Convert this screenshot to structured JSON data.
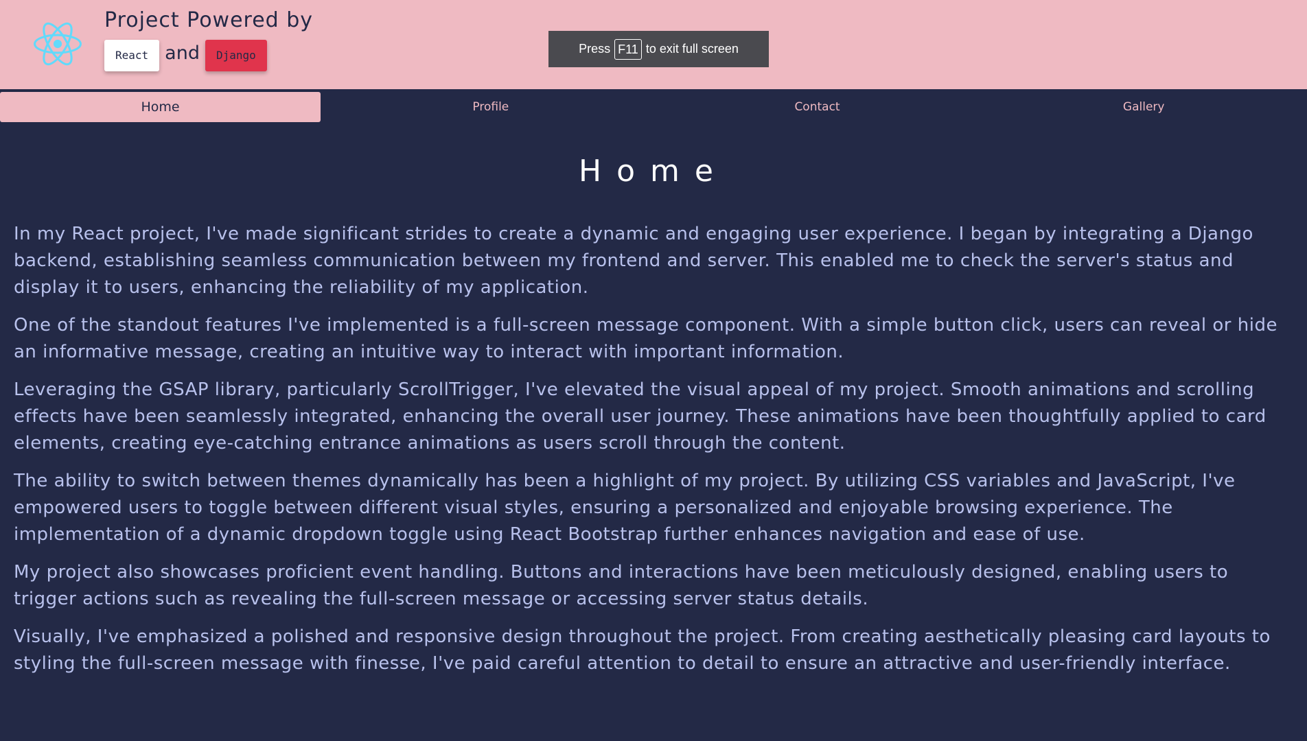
{
  "header": {
    "title": "Project Powered by",
    "badge_react": "React",
    "and_text": "and",
    "badge_django": "Django",
    "logo_color": "#61dafb"
  },
  "fullscreen_notice": {
    "before": "Press",
    "key": "F11",
    "after": "to exit full screen"
  },
  "nav": {
    "tabs": [
      {
        "label": "Home",
        "active": true
      },
      {
        "label": "Profile",
        "active": false
      },
      {
        "label": "Contact",
        "active": false
      },
      {
        "label": "Gallery",
        "active": false
      }
    ]
  },
  "main": {
    "title": "Home",
    "paragraphs": [
      "In my React project, I've made significant strides to create a dynamic and engaging user experience. I began by integrating a Django backend, establishing seamless communication between my frontend and server. This enabled me to check the server's status and display it to users, enhancing the reliability of my application.",
      "One of the standout features I've implemented is a full-screen message component. With a simple button click, users can reveal or hide an informative message, creating an intuitive way to interact with important information.",
      "Leveraging the GSAP library, particularly ScrollTrigger, I've elevated the visual appeal of my project. Smooth animations and scrolling effects have been seamlessly integrated, enhancing the overall user journey. These animations have been thoughtfully applied to card elements, creating eye-catching entrance animations as users scroll through the content.",
      "The ability to switch between themes dynamically has been a highlight of my project. By utilizing CSS variables and JavaScript, I've empowered users to toggle between different visual styles, ensuring a personalized and enjoyable browsing experience. The implementation of a dynamic dropdown toggle using React Bootstrap further enhances navigation and ease of use.",
      "My project also showcases proficient event handling. Buttons and interactions have been meticulously designed, enabling users to trigger actions such as revealing the full-screen message or accessing server status details.",
      "Visually, I've emphasized a polished and responsive design throughout the project. From creating aesthetically pleasing card layouts to styling the full-screen message with finesse, I've paid careful attention to detail to ensure an attractive and user-friendly interface."
    ]
  },
  "colors": {
    "background": "#232946",
    "header_bg": "#efbac2",
    "text": "#b8c1ec",
    "django_badge": "#e0344c"
  }
}
